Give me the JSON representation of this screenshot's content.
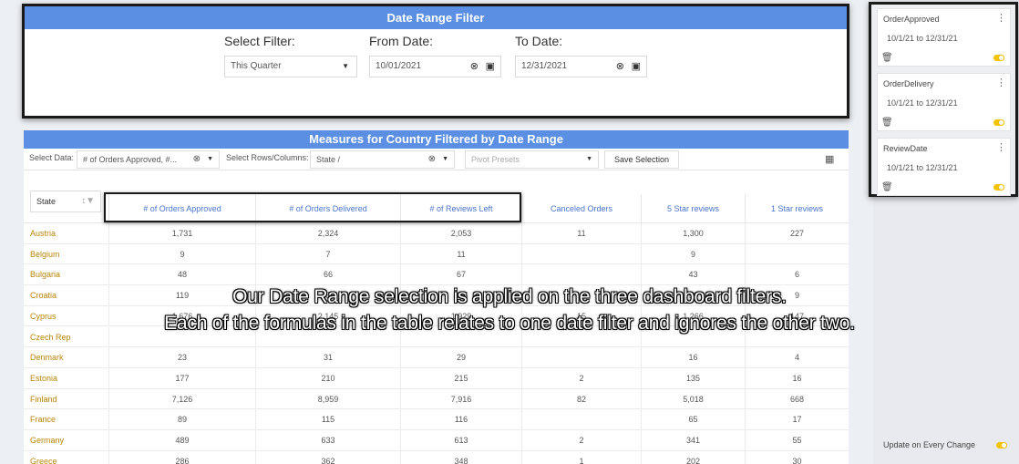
{
  "date_filter": {
    "title": "Date Range Filter",
    "select_label": "Select Filter:",
    "select_value": "This Quarter",
    "from_label": "From Date:",
    "from_value": "10/01/2021",
    "to_label": "To Date:",
    "to_value": "12/31/2021"
  },
  "side_filters": [
    {
      "name": "OrderApproved",
      "range": "10/1/21 to 12/31/21"
    },
    {
      "name": "OrderDelivery",
      "range": "10/1/21 to 12/31/21"
    },
    {
      "name": "ReviewDate",
      "range": "10/1/21 to 12/31/21"
    }
  ],
  "update_label": "Update on Every Change",
  "measures": {
    "title": "Measures for Country Filtered by Date Range",
    "select_data_label": "Select Data:",
    "select_data_value": "# of Orders Approved, #...",
    "rows_cols_label": "Select Rows/Columns:",
    "rows_cols_value": "State /",
    "pivot_presets": "Pivot Presets",
    "save_selection": "Save Selection",
    "state_header": "State",
    "columns": [
      "# of Orders Approved",
      "# of Orders Delivered",
      "# of Reviews Left",
      "Canceled Orders",
      "5 Star reviews",
      "1 Star reviews"
    ],
    "rows": [
      {
        "state": "Austria",
        "v": [
          "1,731",
          "2,324",
          "2,053",
          "11",
          "1,300",
          "227"
        ]
      },
      {
        "state": "Belgium",
        "v": [
          "9",
          "7",
          "11",
          "",
          "9",
          ""
        ]
      },
      {
        "state": "Bulgaria",
        "v": [
          "48",
          "66",
          "67",
          "",
          "43",
          "6"
        ]
      },
      {
        "state": "Croatia",
        "v": [
          "119",
          "150",
          "145",
          "",
          "96",
          "9"
        ]
      },
      {
        "state": "Cyprus",
        "v": [
          "1,676",
          "2,145",
          "1,929",
          "15",
          "1,266",
          "147"
        ]
      },
      {
        "state": "Czech Rep",
        "v": [
          "",
          "",
          "",
          "",
          "",
          ""
        ]
      },
      {
        "state": "Denmark",
        "v": [
          "23",
          "31",
          "29",
          "",
          "16",
          "4"
        ]
      },
      {
        "state": "Estonia",
        "v": [
          "177",
          "210",
          "215",
          "2",
          "135",
          "16"
        ]
      },
      {
        "state": "Finland",
        "v": [
          "7,126",
          "8,959",
          "7,916",
          "82",
          "5,018",
          "668"
        ]
      },
      {
        "state": "France",
        "v": [
          "89",
          "115",
          "116",
          "",
          "65",
          "17"
        ]
      },
      {
        "state": "Germany",
        "v": [
          "489",
          "633",
          "613",
          "2",
          "341",
          "55"
        ]
      },
      {
        "state": "Greece",
        "v": [
          "286",
          "362",
          "348",
          "1",
          "202",
          "30"
        ]
      }
    ]
  },
  "caption": {
    "line1": "Our Date Range selection is applied on the three dashboard filters.",
    "line2": "Each of the formulas in the table relates to one date filter and ignores the other two."
  },
  "icons": [
    "chevron-down-icon",
    "clear-icon",
    "calendar-icon",
    "kebab-menu-icon",
    "trash-icon",
    "toggle-icon",
    "sort-icon",
    "filter-icon",
    "calculator-icon"
  ],
  "colors": {
    "header_blue": "#5b8fe3",
    "state_gold": "#b8860b",
    "toggle_yellow": "#f3c300"
  }
}
